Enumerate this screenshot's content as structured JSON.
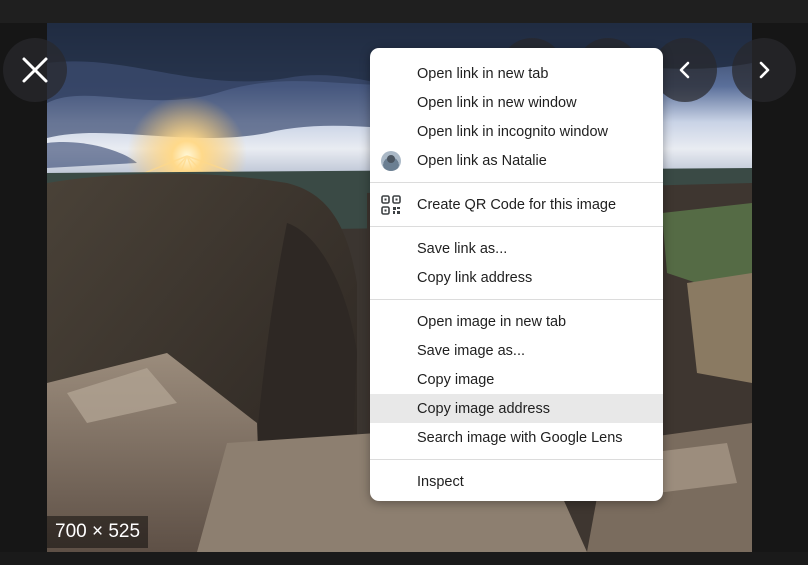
{
  "viewer": {
    "dimensions": "700 × 525",
    "buttons": {
      "close": "close-icon",
      "prev": "chevron-left-icon",
      "next": "chevron-right-icon"
    }
  },
  "context_menu": {
    "groups": [
      [
        {
          "label": "Open link in new tab"
        },
        {
          "label": "Open link in new window"
        },
        {
          "label": "Open link in incognito window"
        },
        {
          "label": "Open link as Natalie",
          "icon": "avatar"
        }
      ],
      [
        {
          "label": "Create QR Code for this image",
          "icon": "qr-code-icon"
        }
      ],
      [
        {
          "label": "Save link as..."
        },
        {
          "label": "Copy link address"
        }
      ],
      [
        {
          "label": "Open image in new tab"
        },
        {
          "label": "Save image as..."
        },
        {
          "label": "Copy image"
        },
        {
          "label": "Copy image address",
          "highlighted": true
        },
        {
          "label": "Search image with Google Lens"
        }
      ],
      [
        {
          "label": "Inspect"
        }
      ]
    ]
  }
}
